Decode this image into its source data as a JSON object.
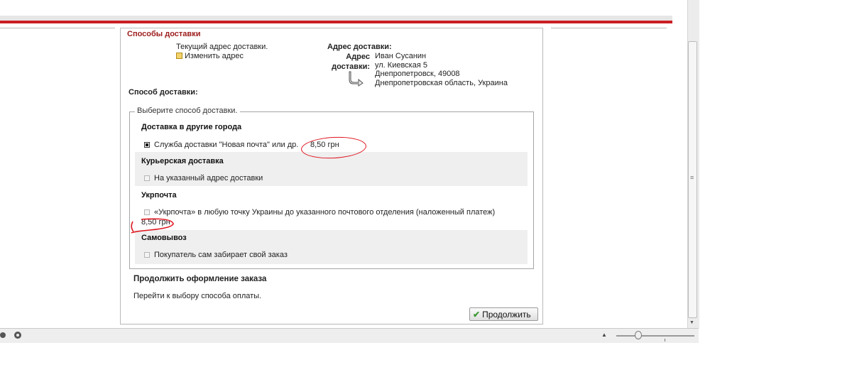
{
  "section_title": "Способы доставки",
  "current_address": {
    "label": "Текущий адрес доставки.",
    "change_link": "Изменить адрес"
  },
  "shipping_address": {
    "heading": "Адрес доставки:",
    "label_line1": "Адрес",
    "label_line2": "доставки:",
    "lines": [
      "Иван Сусанин",
      "ул. Киевская 5",
      "Днепропетровск, 49008",
      "Днепропетровская область, Украина"
    ]
  },
  "delivery_method_heading": "Способ доставки:",
  "legend": "Выберите способ доставки.",
  "groups": [
    {
      "title": "Доставка в другие города",
      "option": "Служба доставки \"Новая почта\" или др.",
      "price": "8,50 грн",
      "selected": true
    },
    {
      "title": "Курьерская доставка",
      "option": "На указанный адрес доставки",
      "selected": false
    },
    {
      "title": "Укрпочта",
      "option": "«Укрпочта» в любую точку Украины до указанного почтового отделения (наложенный платеж)",
      "price": "8,50 грн",
      "selected": false
    },
    {
      "title": "Самовывоз",
      "option": "Покупатель сам забирает свой заказ",
      "selected": false
    }
  ],
  "continue_section": {
    "title": "Продолжить оформление заказа",
    "text": "Перейти к выбору способа оплаты.",
    "button_label": "Продолжить"
  },
  "colors": {
    "accent_red": "#cc1e22",
    "section_title": "#9c1a1a",
    "annotation_red": "#e0141e",
    "check_green": "#3c9a33"
  }
}
